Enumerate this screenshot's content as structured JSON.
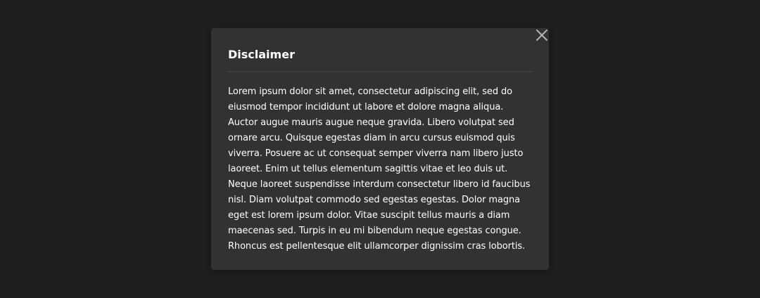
{
  "dialog": {
    "title": "Disclaimer",
    "body": "Lorem ipsum dolor sit amet, consectetur adipiscing elit, sed do eiusmod tempor incididunt ut labore et dolore magna aliqua. Auctor augue mauris augue neque gravida. Libero volutpat sed ornare arcu. Quisque egestas diam in arcu cursus euismod quis viverra. Posuere ac ut consequat semper viverra nam libero justo laoreet. Enim ut tellus elementum sagittis vitae et leo duis ut. Neque laoreet suspendisse interdum consectetur libero id faucibus nisl. Diam volutpat commodo sed egestas egestas. Dolor magna eget est lorem ipsum dolor. Vitae suscipit tellus mauris a diam maecenas sed. Turpis in eu mi bibendum neque egestas congue. Rhoncus est pellentesque elit ullamcorper dignissim cras lobortis.",
    "close_icon": "close-icon"
  },
  "colors": {
    "background": "#1e1e1e",
    "dialog_bg": "#323232",
    "divider": "#3e3e3e",
    "text": "#ffffff",
    "close_icon": "#b3b3b3"
  }
}
